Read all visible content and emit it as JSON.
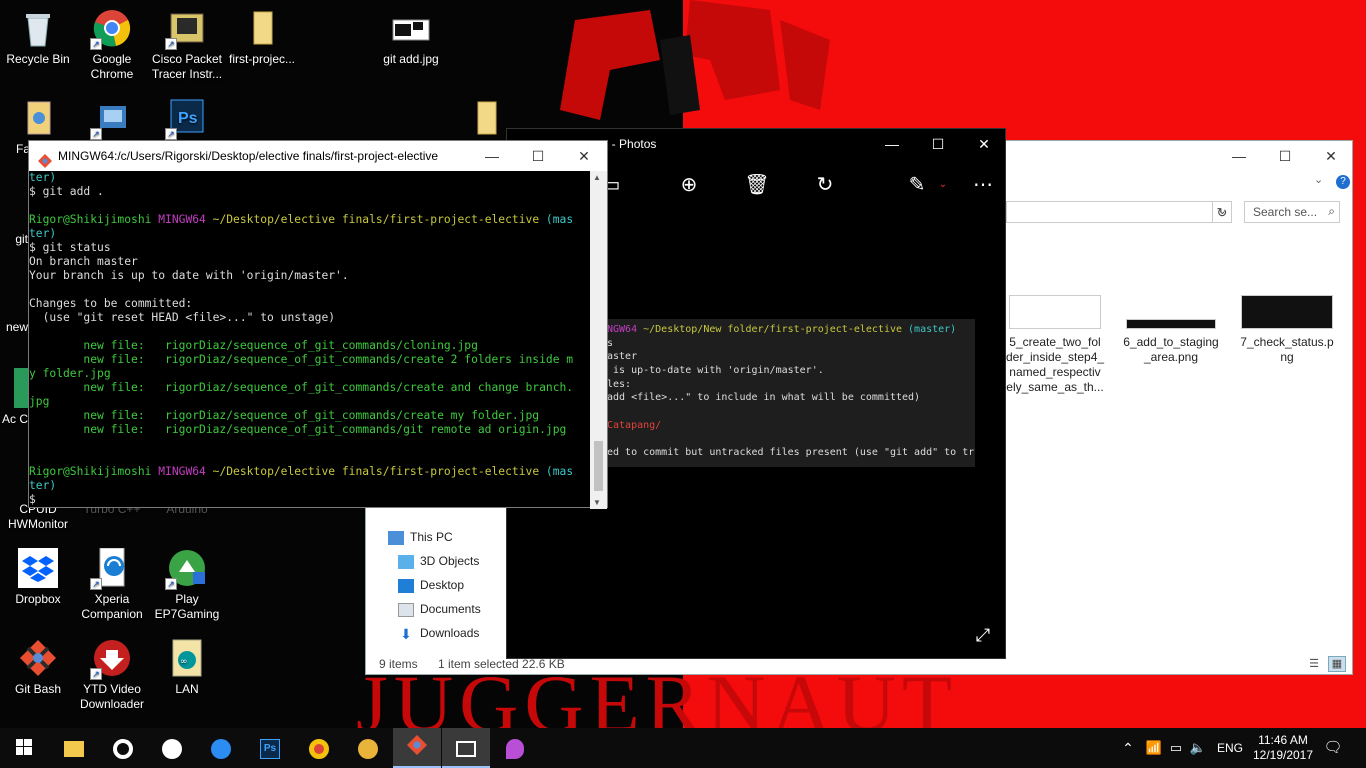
{
  "desktop": {
    "icons": [
      {
        "label": "Recycle Bin",
        "icon": "recycle-bin-icon"
      },
      {
        "label": "Google Chrome",
        "icon": "chrome-icon"
      },
      {
        "label": "Cisco Packet Tracer Instr...",
        "icon": "cisco-packet-tracer-icon"
      },
      {
        "label": "first-projec...",
        "icon": "folder-icon"
      },
      {
        "label": "git add.jpg",
        "icon": "image-file-icon"
      },
      {
        "label": "Fa",
        "icon": "file-icon"
      },
      {
        "label": "git",
        "icon": "file-icon"
      },
      {
        "label": "new",
        "icon": "folder-icon"
      },
      {
        "label": "Ac C",
        "icon": "app-icon"
      },
      {
        "label": "CPUID HWMonitor",
        "icon": "hwmonitor-icon"
      },
      {
        "label": "Turbo C++",
        "icon": "turbo-c-icon"
      },
      {
        "label": "Arduino",
        "icon": "arduino-icon"
      },
      {
        "label": "Dropbox",
        "icon": "dropbox-icon"
      },
      {
        "label": "Xperia Companion",
        "icon": "xperia-companion-icon"
      },
      {
        "label": "Play EP7Gaming",
        "icon": "ep7gaming-icon"
      },
      {
        "label": "Git Bash",
        "icon": "git-bash-icon"
      },
      {
        "label": "YTD Video Downloader",
        "icon": "ytd-downloader-icon"
      },
      {
        "label": "LAN",
        "icon": "arduino-icon"
      }
    ],
    "wallpaper_text": "JUGGERNAUT",
    "colors": {
      "wall_red": "#f40b0b",
      "wall_black": "#050505"
    }
  },
  "terminal": {
    "title": "MINGW64:/c/Users/Rigorski/Desktop/elective finals/first-project-elective",
    "lines": [
      [
        {
          "t": "ter)",
          "c": "c-cyan"
        }
      ],
      [
        {
          "t": "$ git add .",
          "c": ""
        }
      ],
      [
        {
          "t": "",
          "c": ""
        }
      ],
      [
        {
          "t": "Rigor@Shikijimoshi ",
          "c": "c-green"
        },
        {
          "t": "MINGW64 ",
          "c": "c-magenta"
        },
        {
          "t": "~/Desktop/elective finals/first-project-elective ",
          "c": "c-yellow"
        },
        {
          "t": "(mas",
          "c": "c-cyan"
        }
      ],
      [
        {
          "t": "ter)",
          "c": "c-cyan"
        }
      ],
      [
        {
          "t": "$ git status",
          "c": ""
        }
      ],
      [
        {
          "t": "On branch master",
          "c": ""
        }
      ],
      [
        {
          "t": "Your branch is up to date with 'origin/master'.",
          "c": ""
        }
      ],
      [
        {
          "t": "",
          "c": ""
        }
      ],
      [
        {
          "t": "Changes to be committed:",
          "c": ""
        }
      ],
      [
        {
          "t": "  (use \"git reset HEAD <file>...\" to unstage)",
          "c": ""
        }
      ],
      [
        {
          "t": "",
          "c": ""
        }
      ],
      [
        {
          "t": "        new file:   rigorDiaz/sequence_of_git_commands/cloning.jpg",
          "c": "c-green"
        }
      ],
      [
        {
          "t": "        new file:   rigorDiaz/sequence_of_git_commands/create 2 folders inside m",
          "c": "c-green"
        }
      ],
      [
        {
          "t": "y folder.jpg",
          "c": "c-green"
        }
      ],
      [
        {
          "t": "        new file:   rigorDiaz/sequence_of_git_commands/create and change branch.",
          "c": "c-green"
        }
      ],
      [
        {
          "t": "jpg",
          "c": "c-green"
        }
      ],
      [
        {
          "t": "        new file:   rigorDiaz/sequence_of_git_commands/create my folder.jpg",
          "c": "c-green"
        }
      ],
      [
        {
          "t": "        new file:   rigorDiaz/sequence_of_git_commands/git remote ad origin.jpg",
          "c": "c-green"
        }
      ],
      [
        {
          "t": "",
          "c": ""
        }
      ],
      [
        {
          "t": "",
          "c": ""
        }
      ],
      [
        {
          "t": "Rigor@Shikijimoshi ",
          "c": "c-green"
        },
        {
          "t": "MINGW64 ",
          "c": "c-magenta"
        },
        {
          "t": "~/Desktop/elective finals/first-project-elective ",
          "c": "c-yellow"
        },
        {
          "t": "(mas",
          "c": "c-cyan"
        }
      ],
      [
        {
          "t": "ter)",
          "c": "c-cyan"
        }
      ],
      [
        {
          "t": "$",
          "c": ""
        }
      ]
    ]
  },
  "photos": {
    "title": "ng - Photos",
    "image_lines": [
      [
        {
          "t": "NGW64 ",
          "c": "c-magenta"
        },
        {
          "t": "~/Desktop/New folder/first-project-elective ",
          "c": "c-yellow"
        },
        {
          "t": "(master)",
          "c": "c-cyan"
        }
      ],
      [
        {
          "t": "s",
          "c": ""
        }
      ],
      [
        {
          "t": "aster",
          "c": ""
        }
      ],
      [
        {
          "t": " is up-to-date with 'origin/master'.",
          "c": ""
        }
      ],
      [
        {
          "t": "les:",
          "c": ""
        }
      ],
      [
        {
          "t": "add <file>...\" to include in what will be committed)",
          "c": ""
        }
      ],
      [
        {
          "t": "",
          "c": ""
        }
      ],
      [
        {
          "t": "Catapang/",
          "c": "c-red"
        }
      ],
      [
        {
          "t": "",
          "c": ""
        }
      ],
      [
        {
          "t": "ed to commit but untracked files present (use \"git add\" to track)",
          "c": ""
        }
      ]
    ]
  },
  "explorer": {
    "search_placeholder": "Search se...",
    "files": [
      {
        "name": "5_create_two_fol der_inside_step4_ named_respectiv ely_same_as_th..."
      },
      {
        "name": "6_add_to_staging _area.png"
      },
      {
        "name": "7_check_status.p ng"
      }
    ],
    "nav": [
      {
        "label": "This PC",
        "icon": "this-pc-icon"
      },
      {
        "label": "3D Objects",
        "icon": "3d-objects-icon"
      },
      {
        "label": "Desktop",
        "icon": "desktop-folder-icon"
      },
      {
        "label": "Documents",
        "icon": "documents-icon"
      },
      {
        "label": "Downloads",
        "icon": "downloads-icon"
      }
    ],
    "status": {
      "items": "9 items",
      "selected": "1 item selected  22.6 KB"
    }
  },
  "taskbar": {
    "apps": [
      {
        "icon": "file-explorer-icon"
      },
      {
        "icon": "cortana-icon"
      },
      {
        "icon": "steam-icon"
      },
      {
        "icon": "messenger-icon"
      },
      {
        "icon": "photoshop-icon"
      },
      {
        "icon": "chrome-icon"
      },
      {
        "icon": "coin-app-icon"
      },
      {
        "icon": "git-bash-icon"
      },
      {
        "icon": "photos-icon"
      },
      {
        "icon": "paint-3d-icon"
      }
    ],
    "lang": "ENG",
    "time": "11:46 AM",
    "date": "12/19/2017"
  }
}
